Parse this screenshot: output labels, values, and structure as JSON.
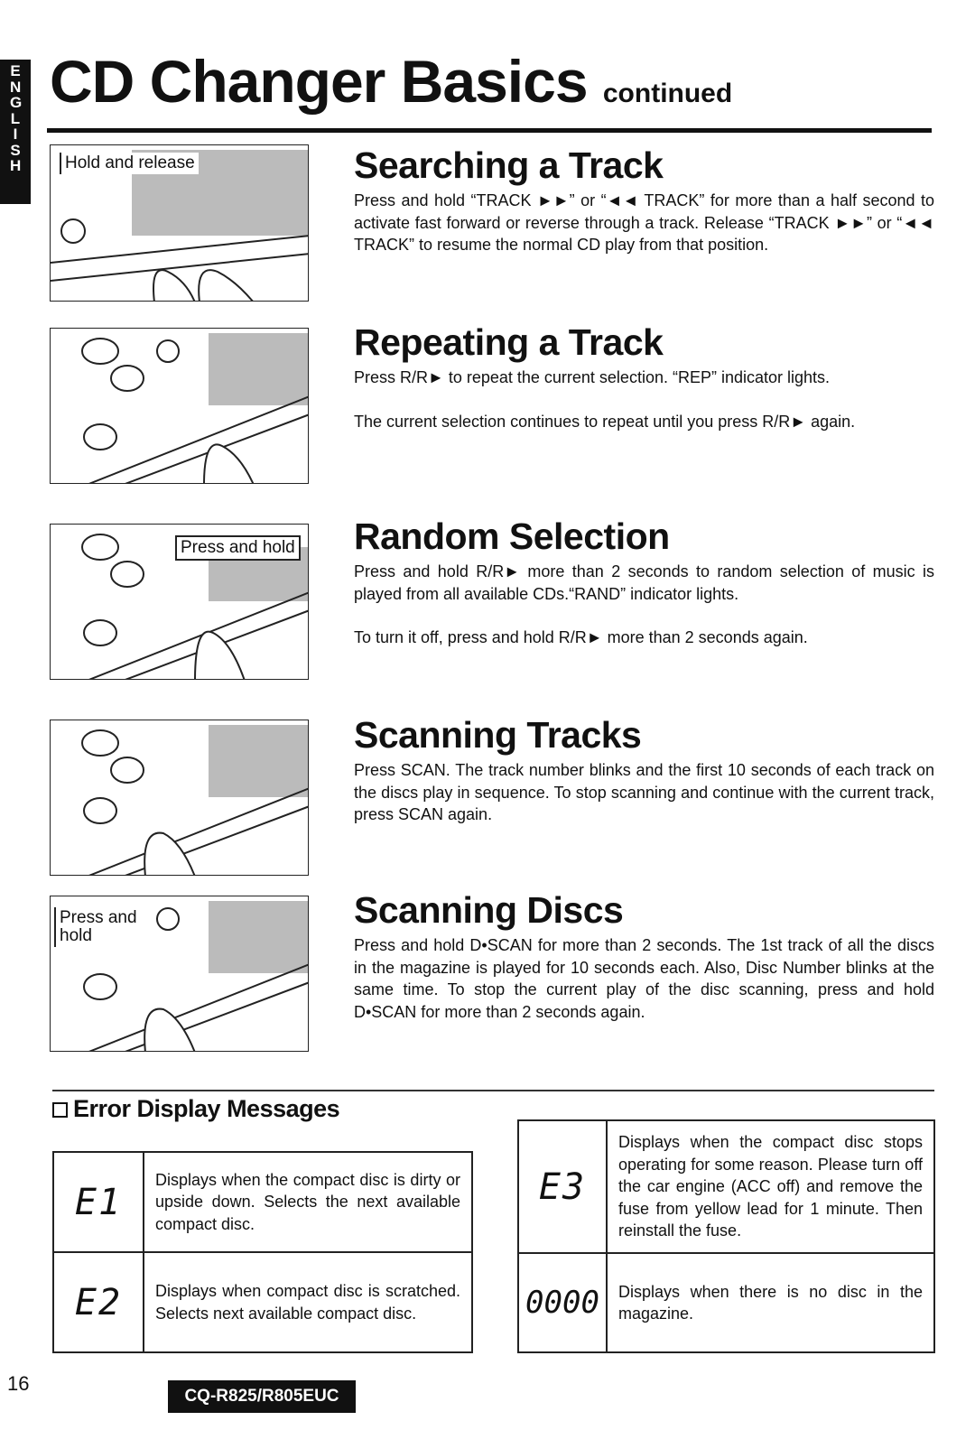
{
  "language_tab": "ENGLISH",
  "title": "CD Changer Basics",
  "title_suffix": "continued",
  "sections": [
    {
      "heading": "Searching a Track",
      "paragraphs": [
        "Press and hold “TRACK ►►” or “◄◄ TRACK” for more than a half second to activate fast forward or reverse through a track. Release “TRACK ►►” or “◄◄ TRACK” to resume the normal CD play from that position."
      ],
      "callout": "Hold and release"
    },
    {
      "heading": "Repeating a Track",
      "paragraphs": [
        "Press R/R► to repeat the current selection. “REP” indicator lights.",
        "The current selection continues to repeat until you press R/R► again."
      ]
    },
    {
      "heading": "Random Selection",
      "paragraphs": [
        "Press and hold R/R► more than 2 seconds to random selection of music is played from all available CDs.“RAND” indicator lights.",
        "To turn it off, press and hold R/R► more than 2 seconds again."
      ],
      "callout": "Press and hold"
    },
    {
      "heading": "Scanning Tracks",
      "paragraphs": [
        "Press SCAN. The track number blinks and the first 10 seconds of each track on the discs play in sequence. To stop scanning and continue with the current track, press SCAN again."
      ]
    },
    {
      "heading": "Scanning Discs",
      "paragraphs": [
        "Press and hold D•SCAN for more than 2 seconds. The 1st track of all the discs in the magazine is played for 10 seconds each. Also, Disc Number blinks at the same time. To stop the current play of the disc scanning, press and hold D•SCAN for more than 2 seconds again."
      ],
      "callout": "Press and hold"
    }
  ],
  "errors": {
    "heading": "Error Display Messages",
    "items": [
      {
        "code": "E1",
        "text": "Displays when the compact disc is dirty or upside down. Selects the next available compact disc."
      },
      {
        "code": "E2",
        "text": "Displays when compact disc is scratched. Selects next available compact disc."
      },
      {
        "code": "E3",
        "text": "Displays when the compact disc stops operating for some reason. Please turn off the car engine (ACC off) and remove the fuse from yellow lead for 1 minute. Then reinstall the fuse."
      },
      {
        "code": "0000",
        "text": "Displays when there is no disc in the magazine."
      }
    ]
  },
  "page_number": "16",
  "model": "CQ-R825/R805EUC"
}
